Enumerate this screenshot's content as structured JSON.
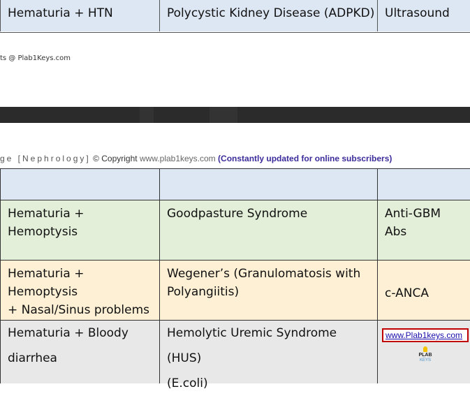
{
  "top_row": {
    "symptom": "Hematuria + HTN",
    "diagnosis": "Polycystic Kidney Disease (ADPKD)",
    "test": "Ultrasound"
  },
  "footer_text": "ts @ Plab1Keys.com",
  "header": {
    "prefix": "ge [Nephrology]",
    "copyright": "© Copyright",
    "url": "www.plab1keys.com",
    "open_paren": "(",
    "note": "Constantly updated for online subscribers",
    "close_paren": ")"
  },
  "table": {
    "header_row": [
      "",
      "",
      ""
    ],
    "rows": [
      {
        "symptom": [
          "Hematuria + Hemoptysis"
        ],
        "diagnosis": [
          "Goodpasture Syndrome"
        ],
        "test": "Anti-GBM Abs"
      },
      {
        "symptom": [
          "Hematuria + Hemoptysis",
          "+ Nasal/Sinus problems"
        ],
        "diagnosis": [
          "Wegener’s (Granulomatosis with",
          "Polyangiitis)"
        ],
        "test": "c-ANCA"
      },
      {
        "symptom": [
          "Hematuria + Bloody",
          "diarrhea"
        ],
        "diagnosis": [
          "Hemolytic Uremic Syndrome (HUS)",
          "(E.coli)"
        ],
        "test": ""
      }
    ]
  },
  "link": "www.Plab1keys.com",
  "logo": {
    "line1": "PLAB",
    "line2": "KEYS"
  },
  "colors": {
    "blue_row": "#dde7f4",
    "green_row": "#e3efd9",
    "yellow_row": "#fdf0d5",
    "gray_row": "#e8e8e8",
    "link_border": "#c00000"
  }
}
